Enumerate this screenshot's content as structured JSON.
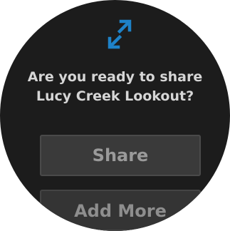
{
  "icon": {
    "name": "share-arrows-icon",
    "color": "#1e82c8"
  },
  "prompt": {
    "line1": "Are you ready to share",
    "line2": "Lucy Creek Lookout?"
  },
  "buttons": {
    "share_label": "Share",
    "add_more_label": "Add More"
  }
}
